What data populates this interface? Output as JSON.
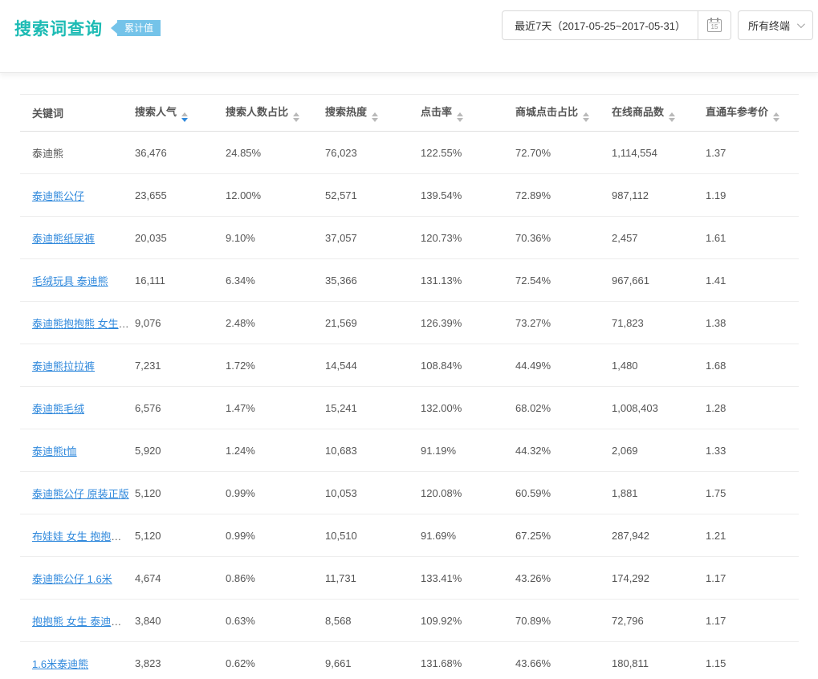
{
  "page": {
    "title": "搜索词查询",
    "badge": "累计值"
  },
  "toolbar": {
    "date_range": "最近7天（2017-05-25~2017-05-31）",
    "calendar_day": "15",
    "terminal_selector": "所有终端"
  },
  "colors": {
    "title_teal": "#1cbbb4",
    "badge_blue": "#74c3e9",
    "link_blue": "#3089dc",
    "sort_active_blue": "#3089dc",
    "text_gray": "#555555"
  },
  "table": {
    "columns": [
      {
        "label": "关键词",
        "sortable": false,
        "sort": null
      },
      {
        "label": "搜索人气",
        "sortable": true,
        "sort": "desc"
      },
      {
        "label": "搜索人数占比",
        "sortable": true,
        "sort": null
      },
      {
        "label": "搜索热度",
        "sortable": true,
        "sort": null
      },
      {
        "label": "点击率",
        "sortable": true,
        "sort": null
      },
      {
        "label": "商城点击占比",
        "sortable": true,
        "sort": null
      },
      {
        "label": "在线商品数",
        "sortable": true,
        "sort": null
      },
      {
        "label": "直通车参考价",
        "sortable": true,
        "sort": null
      }
    ],
    "rows": [
      {
        "keyword": "泰迪熊",
        "is_link": false,
        "values": [
          "36,476",
          "24.85%",
          "76,023",
          "122.55%",
          "72.70%",
          "1,114,554",
          "1.37"
        ]
      },
      {
        "keyword": "泰迪熊公仔",
        "is_link": true,
        "values": [
          "23,655",
          "12.00%",
          "52,571",
          "139.54%",
          "72.89%",
          "987,112",
          "1.19"
        ]
      },
      {
        "keyword": "泰迪熊纸尿裤",
        "is_link": true,
        "values": [
          "20,035",
          "9.10%",
          "37,057",
          "120.73%",
          "70.36%",
          "2,457",
          "1.61"
        ]
      },
      {
        "keyword": "毛绒玩具 泰迪熊",
        "is_link": true,
        "values": [
          "16,111",
          "6.34%",
          "35,366",
          "131.13%",
          "72.54%",
          "967,661",
          "1.41"
        ]
      },
      {
        "keyword": "泰迪熊抱抱熊 女生 送...",
        "is_link": true,
        "values": [
          "9,076",
          "2.48%",
          "21,569",
          "126.39%",
          "73.27%",
          "71,823",
          "1.38"
        ]
      },
      {
        "keyword": "泰迪熊拉拉裤",
        "is_link": true,
        "values": [
          "7,231",
          "1.72%",
          "14,544",
          "108.84%",
          "44.49%",
          "1,480",
          "1.68"
        ]
      },
      {
        "keyword": "泰迪熊毛绒",
        "is_link": true,
        "values": [
          "6,576",
          "1.47%",
          "15,241",
          "132.00%",
          "68.02%",
          "1,008,403",
          "1.28"
        ]
      },
      {
        "keyword": "泰迪熊t恤",
        "is_link": true,
        "values": [
          "5,920",
          "1.24%",
          "10,683",
          "91.19%",
          "44.32%",
          "2,069",
          "1.33"
        ]
      },
      {
        "keyword": "泰迪熊公仔 原装正版",
        "is_link": true,
        "values": [
          "5,120",
          "0.99%",
          "10,053",
          "120.08%",
          "60.59%",
          "1,881",
          "1.75"
        ]
      },
      {
        "keyword": "布娃娃 女生 抱抱熊 泰...",
        "is_link": true,
        "values": [
          "5,120",
          "0.99%",
          "10,510",
          "91.69%",
          "67.25%",
          "287,942",
          "1.21"
        ]
      },
      {
        "keyword": "泰迪熊公仔 1.6米",
        "is_link": true,
        "values": [
          "4,674",
          "0.86%",
          "11,731",
          "133.41%",
          "43.26%",
          "174,292",
          "1.17"
        ]
      },
      {
        "keyword": "抱抱熊 女生 泰迪熊 送...",
        "is_link": true,
        "values": [
          "3,840",
          "0.63%",
          "8,568",
          "109.92%",
          "70.89%",
          "72,796",
          "1.17"
        ]
      },
      {
        "keyword": "1.6米泰迪熊",
        "is_link": true,
        "values": [
          "3,823",
          "0.62%",
          "9,661",
          "131.68%",
          "43.66%",
          "180,811",
          "1.15"
        ]
      }
    ]
  }
}
